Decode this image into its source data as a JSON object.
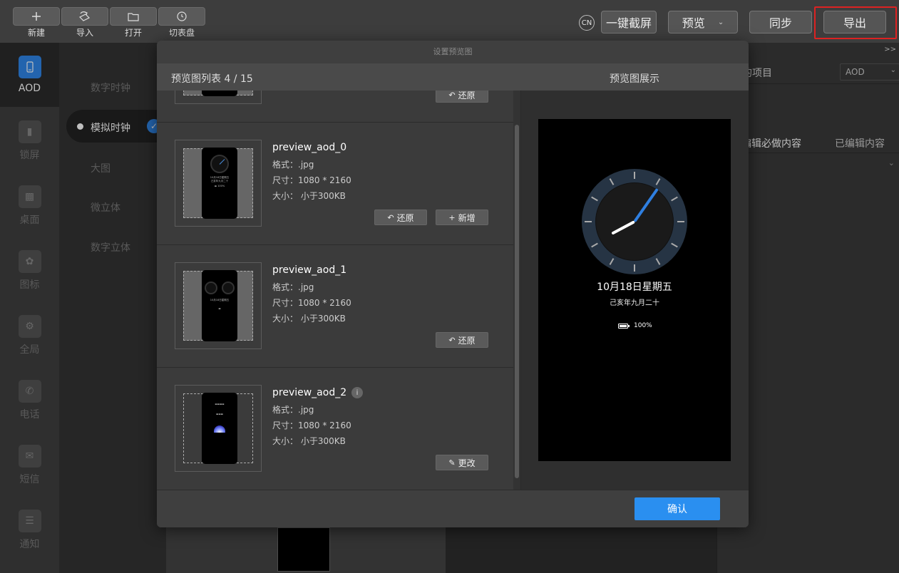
{
  "toolbar": {
    "items": [
      {
        "label": "新建",
        "icon": "plus-icon"
      },
      {
        "label": "导入",
        "icon": "import-icon"
      },
      {
        "label": "打开",
        "icon": "folder-icon"
      },
      {
        "label": "切表盘",
        "icon": "watch-icon"
      }
    ],
    "lang": "CN",
    "screenshot_label": "一键截屏",
    "preview_label": "预览",
    "sync_label": "同步",
    "export_label": "导出",
    "highlight_color": "#dd2222"
  },
  "sidebar": {
    "items": [
      {
        "label": "AOD",
        "active": true
      },
      {
        "label": "锁屏"
      },
      {
        "label": "桌面"
      },
      {
        "label": "图标"
      },
      {
        "label": "全局"
      },
      {
        "label": "电话"
      },
      {
        "label": "短信"
      },
      {
        "label": "通知"
      }
    ]
  },
  "subnav": {
    "items": [
      "数字时钟",
      "模拟时钟",
      "大图",
      "微立体",
      "数字立体"
    ],
    "active_index": 1
  },
  "rightpanel": {
    "arrows": ">>",
    "row_label": "的项目",
    "select_value": "AOD",
    "tab_required": "编辑必做内容",
    "tab_edited": "已编辑内容"
  },
  "modal": {
    "title": "设置预览图",
    "list_title": "预览图列表 4 / 15",
    "preview_title": "预览图展示",
    "confirm_label": "确认",
    "items": [
      {
        "name": "preview_aod_0",
        "format": "格式：.jpg",
        "size": "尺寸：1080 * 2160",
        "filesize": "大小： 小于300KB",
        "restore_label": "还原",
        "add_label": "新增"
      },
      {
        "name": "preview_aod_1",
        "format": "格式：.jpg",
        "size": "尺寸：1080 * 2160",
        "filesize": "大小： 小于300KB",
        "restore_label": "还原"
      },
      {
        "name": "preview_aod_2",
        "info": "i",
        "format": "格式：.jpg",
        "size": "尺寸：1080 * 2160",
        "filesize": "大小： 小于300KB",
        "change_label": "更改"
      }
    ],
    "top_partial_restore": "还原",
    "preview": {
      "date": "10月18日星期五",
      "lunar": "己亥年九月二十",
      "battery": "100%",
      "accent": "#2f7fe0"
    }
  }
}
